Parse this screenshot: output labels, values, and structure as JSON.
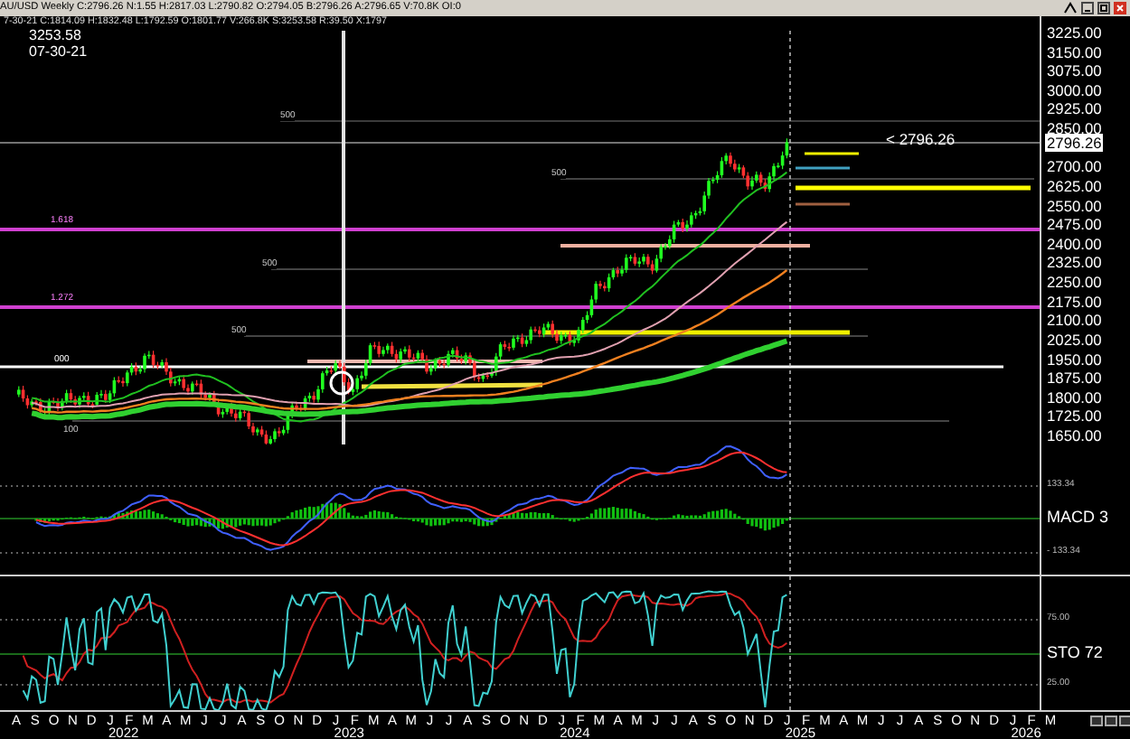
{
  "header": {
    "quote_line": "AU/USD Weekly C:2796.26 N:1.55 H:2817.03 L:2790.82 O:2794.05 B:2796.26 A:2796.65 V:70.8K OI:0"
  },
  "price_pane": {
    "info_line": "7-30-21 C:1814.09 H:1832.48 L:1792.59 O:1801.77 V:266.8K S:3253.58 R:39.50 X:1797",
    "cursor_value": "3253.58",
    "cursor_date": "07-30-21",
    "price_callout": "< 2796.26",
    "level_labels": [
      {
        "text": "500",
        "kind": "grey"
      },
      {
        "text": "500",
        "kind": "grey"
      },
      {
        "text": "1.618",
        "kind": "fib"
      },
      {
        "text": "500",
        "kind": "grey"
      },
      {
        "text": "1.272",
        "kind": "fib"
      },
      {
        "text": "500",
        "kind": "grey"
      },
      {
        "text": "000",
        "kind": "white"
      },
      {
        "text": "100",
        "kind": "grey"
      }
    ]
  },
  "price_axis": {
    "labels": [
      "3225.00",
      "3150.00",
      "3075.00",
      "3000.00",
      "2925.00",
      "2850.00",
      "2700.00",
      "2625.00",
      "2550.00",
      "2475.00",
      "2400.00",
      "2325.00",
      "2250.00",
      "2175.00",
      "2100.00",
      "2025.00",
      "1950.00",
      "1875.00",
      "1800.00",
      "1725.00",
      "1650.00"
    ],
    "current": "2796.26"
  },
  "macd_pane": {
    "upper": "133.34",
    "name": "MACD 3",
    "lower": "- 133.34"
  },
  "sto_pane": {
    "upper": "75.00",
    "name": "STO  72",
    "lower": "25.00"
  },
  "time_axis": {
    "months": [
      "A",
      "S",
      "O",
      "N",
      "D",
      "J",
      "F",
      "M",
      "A",
      "M",
      "J",
      "J",
      "A",
      "S",
      "O",
      "N",
      "D",
      "J",
      "F",
      "M",
      "A",
      "M",
      "J",
      "J",
      "A",
      "S",
      "O",
      "N",
      "D",
      "J",
      "F",
      "M",
      "A",
      "M",
      "J",
      "J",
      "A",
      "S",
      "O",
      "N",
      "D",
      "J",
      "F",
      "M",
      "A",
      "M",
      "J",
      "J",
      "A",
      "S",
      "O",
      "N",
      "D",
      "J",
      "F",
      "M"
    ],
    "years": [
      "2022",
      "2023",
      "2024",
      "2025",
      "2026"
    ]
  }
}
